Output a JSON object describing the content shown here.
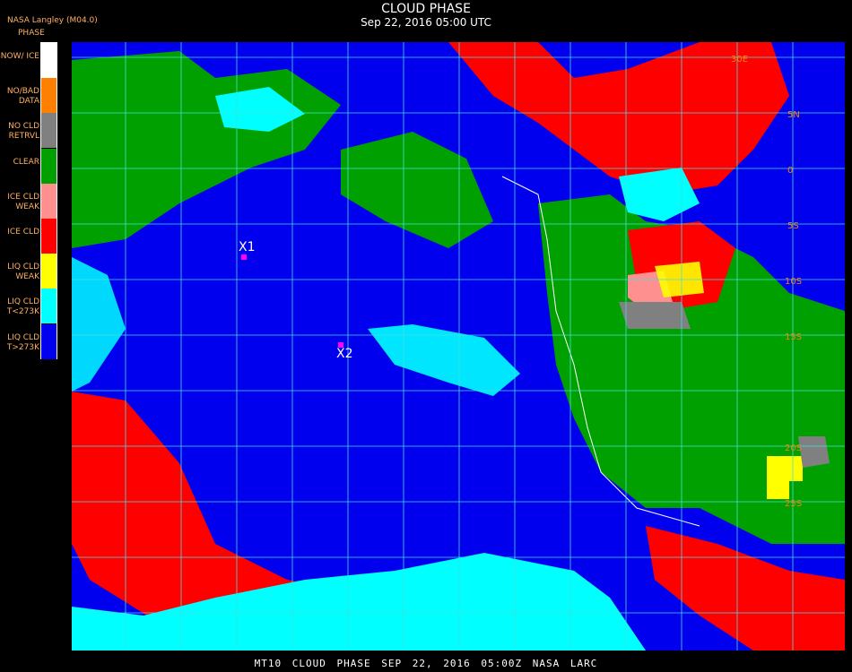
{
  "header": {
    "title": "CLOUD PHASE",
    "subtitle": "Sep 22, 2016 05:00 UTC",
    "agency": "NASA Langley (M04.0)"
  },
  "legend": {
    "title": "PHASE",
    "items": [
      {
        "label": "SNOW/ ICE",
        "color": "#ffffff"
      },
      {
        "label": "NO/BAD DATA",
        "color": "#ff7f00"
      },
      {
        "label": "NO CLD RETRVL",
        "color": "#808080"
      },
      {
        "label": "CLEAR",
        "color": "#00a000"
      },
      {
        "label": "ICE CLD WEAK",
        "color": "#ff9090"
      },
      {
        "label": "ICE CLD",
        "color": "#ff0000"
      },
      {
        "label": "LIQ CLD WEAK",
        "color": "#ffff00"
      },
      {
        "label": "LIQ CLD T<273K",
        "color": "#00ffff"
      },
      {
        "label": "LIQ CLD T>273K",
        "color": "#0000ee"
      }
    ]
  },
  "markers": [
    {
      "label": "X1"
    },
    {
      "label": "X2"
    }
  ],
  "grid_labels": [
    "30E",
    "5N",
    "0",
    "5S",
    "10S",
    "15S",
    "20S",
    "25S"
  ],
  "footer": "MT10  CLOUD PHASE  SEP 22, 2016 05:00Z  NASA LARC"
}
